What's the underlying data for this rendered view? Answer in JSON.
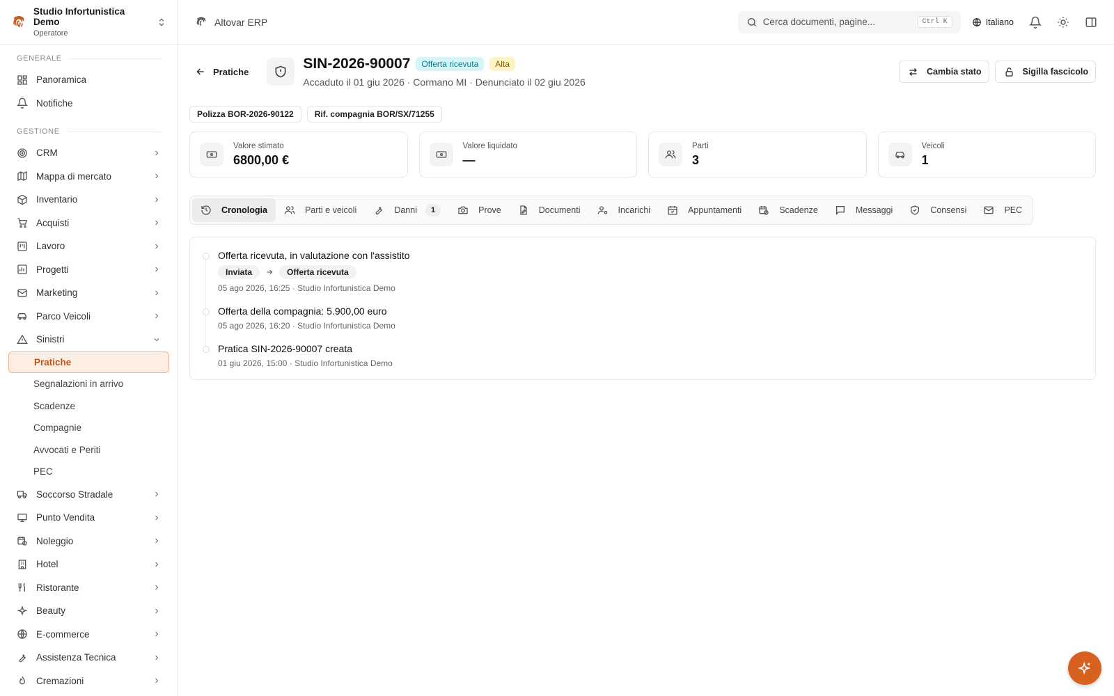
{
  "org": {
    "name": "Studio Infortunistica Demo",
    "role": "Operatore"
  },
  "sidebar": {
    "section_general": "GENERALE",
    "general": [
      {
        "label": "Panoramica"
      },
      {
        "label": "Notifiche"
      }
    ],
    "section_management": "GESTIONE",
    "items": [
      {
        "label": "CRM"
      },
      {
        "label": "Mappa di mercato"
      },
      {
        "label": "Inventario"
      },
      {
        "label": "Acquisti"
      },
      {
        "label": "Lavoro"
      },
      {
        "label": "Progetti"
      },
      {
        "label": "Marketing"
      },
      {
        "label": "Parco Veicoli"
      },
      {
        "label": "Sinistri"
      }
    ],
    "sinistri_sub": [
      {
        "label": "Pratiche"
      },
      {
        "label": "Segnalazioni in arrivo"
      },
      {
        "label": "Scadenze"
      },
      {
        "label": "Compagnie"
      },
      {
        "label": "Avvocati e Periti"
      },
      {
        "label": "PEC"
      }
    ],
    "items_after": [
      {
        "label": "Soccorso Stradale"
      },
      {
        "label": "Punto Vendita"
      },
      {
        "label": "Noleggio"
      },
      {
        "label": "Hotel"
      },
      {
        "label": "Ristorante"
      },
      {
        "label": "Beauty"
      },
      {
        "label": "E-commerce"
      },
      {
        "label": "Assistenza Tecnica"
      },
      {
        "label": "Cremazioni"
      }
    ]
  },
  "topbar": {
    "app_name": "Altovar ERP",
    "search_placeholder": "Cerca documenti, pagine...",
    "shortcut": "Ctrl K",
    "language": "Italiano"
  },
  "header": {
    "back_label": "Pratiche",
    "title": "SIN-2026-90007",
    "status_badge": "Offerta ricevuta",
    "priority_badge": "Alta",
    "subtitle": "Accaduto il 01 giu 2026 · Cormano MI · Denunciato il 02 giu 2026",
    "change_status": "Cambia stato",
    "seal": "Sigilla fascicolo"
  },
  "chips": {
    "policy": "Polizza BOR-2026-90122",
    "company_ref": "Rif. compagnia BOR/SX/71255"
  },
  "stats": [
    {
      "label": "Valore stimato",
      "value": "6800,00 €"
    },
    {
      "label": "Valore liquidato",
      "value": "—"
    },
    {
      "label": "Parti",
      "value": "3"
    },
    {
      "label": "Veicoli",
      "value": "1"
    }
  ],
  "tabs": [
    {
      "label": "Cronologia"
    },
    {
      "label": "Parti e veicoli"
    },
    {
      "label": "Danni",
      "count": "1"
    },
    {
      "label": "Prove"
    },
    {
      "label": "Documenti"
    },
    {
      "label": "Incarichi"
    },
    {
      "label": "Appuntamenti"
    },
    {
      "label": "Scadenze"
    },
    {
      "label": "Messaggi"
    },
    {
      "label": "Consensi"
    },
    {
      "label": "PEC"
    }
  ],
  "timeline": [
    {
      "title": "Offerta ricevuta, in valutazione con l'assistito",
      "from": "Inviata",
      "to": "Offerta ricevuta",
      "meta": "05 ago 2026, 16:25 · Studio Infortunistica Demo"
    },
    {
      "title": "Offerta della compagnia: 5.900,00 euro",
      "meta": "05 ago 2026, 16:20 · Studio Infortunistica Demo"
    },
    {
      "title": "Pratica SIN-2026-90007 creata",
      "meta": "01 giu 2026, 15:00 · Studio Infortunistica Demo"
    }
  ],
  "colors": {
    "accent": "#d9611f",
    "active_bg": "#fdeee4",
    "status_cyan": "#d5f5f9",
    "priority_amber": "#fdf3c4"
  }
}
